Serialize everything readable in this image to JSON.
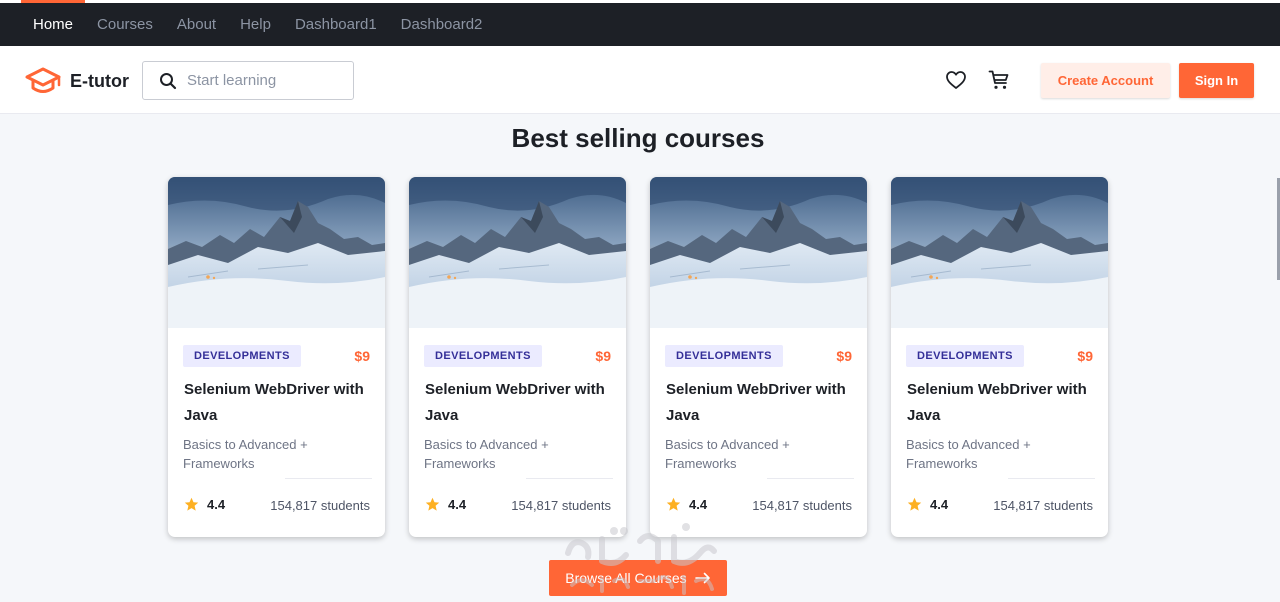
{
  "topnav": {
    "items": [
      {
        "label": "Home",
        "active": true
      },
      {
        "label": "Courses",
        "active": false
      },
      {
        "label": "About",
        "active": false
      },
      {
        "label": "Help",
        "active": false
      },
      {
        "label": "Dashboard1",
        "active": false
      },
      {
        "label": "Dashboard2",
        "active": false
      }
    ]
  },
  "header": {
    "logo_text": "E-tutor",
    "search_placeholder": "Start learning",
    "create_account_label": "Create Account",
    "sign_in_label": "Sign In",
    "icons": [
      "heart-icon",
      "cart-icon",
      "search-icon",
      "graduation-cap-icon"
    ]
  },
  "section": {
    "title": "Best selling courses",
    "browse_label": "Browse All Courses",
    "browse_icon": "arrow-right-icon"
  },
  "courses": [
    {
      "category": "DEVELOPMENTS",
      "price": "$9",
      "title": "Selenium WebDriver with Java",
      "subtitle": "Basics to Advanced + Frameworks",
      "rating": "4.4",
      "students": "154,817 students"
    },
    {
      "category": "DEVELOPMENTS",
      "price": "$9",
      "title": "Selenium WebDriver with Java",
      "subtitle": "Basics to Advanced + Frameworks",
      "rating": "4.4",
      "students": "154,817 students"
    },
    {
      "category": "DEVELOPMENTS",
      "price": "$9",
      "title": "Selenium WebDriver with Java",
      "subtitle": "Basics to Advanced + Frameworks",
      "rating": "4.4",
      "students": "154,817 students"
    },
    {
      "category": "DEVELOPMENTS",
      "price": "$9",
      "title": "Selenium WebDriver with Java",
      "subtitle": "Basics to Advanced + Frameworks",
      "rating": "4.4",
      "students": "154,817 students"
    }
  ],
  "colors": {
    "primary": "#ff6636",
    "primary_light": "#ffeee8",
    "dark": "#1d2026",
    "badge_bg": "#ebebff",
    "badge_text": "#342f98",
    "star": "#fd8e1f"
  }
}
